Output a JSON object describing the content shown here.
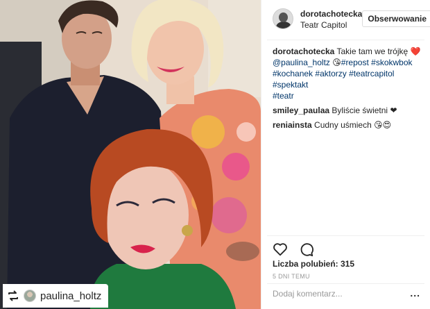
{
  "post": {
    "author": "dorotachotecka",
    "location": "Teatr Capitol",
    "follow_label": "Obserwowanie",
    "caption_user": "dorotachotecka",
    "caption_text": "Takie tam we trójkę",
    "caption_emoji": "❤️",
    "caption_tags_line1": [
      "@paulina_holtz",
      "#repost",
      "#skokwbok"
    ],
    "caption_tags_line1_emoji": "😘",
    "caption_tags_line2": [
      "#kochanek",
      "#aktorzy",
      "#teatrcapitol",
      "#spektakt"
    ],
    "caption_tags_line3": [
      "#teatr"
    ],
    "comments": [
      {
        "user": "smiley_paulaa",
        "text": "Byliście świetni",
        "emoji": "❤"
      },
      {
        "user": "reniainsta",
        "text": "Cudny uśmiech",
        "emoji": "😘😍"
      }
    ],
    "likes_label": "Liczba polubień: 315",
    "date_label": "5 DNI TEMU",
    "comment_placeholder": "Dodaj komentarz...",
    "more_label": "..."
  },
  "photo": {
    "repost_user": "paulina_holtz",
    "icons": [
      "repost-icon",
      "heart-icon",
      "comment-icon",
      "more-icon"
    ]
  },
  "colors": {
    "tag": "#003569",
    "heart": "#ed4956",
    "muted": "#999999",
    "border": "#efefef"
  }
}
